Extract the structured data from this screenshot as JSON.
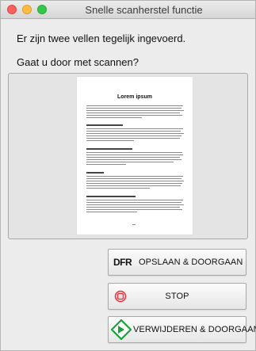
{
  "window": {
    "title": "Snelle scanherstel functie"
  },
  "message": {
    "line1": "Er zijn twee vellen tegelijk ingevoerd.",
    "line2": "Gaat u door met scannen?"
  },
  "preview": {
    "document_title": "Lorem ipsum"
  },
  "buttons": {
    "save_continue": {
      "icon_text": "DFR",
      "label": "OPSLAAN & DOORGAAN"
    },
    "stop": {
      "icon": "stop-icon",
      "label": "STOP"
    },
    "delete_continue": {
      "icon": "green-diamond-arrow-icon",
      "label": "VERWIJDEREN & DOORGAAN"
    }
  },
  "colors": {
    "close": "#fc605c",
    "minimize": "#fdbc40",
    "maximize": "#34c84a",
    "stop_icon": "#e8323c",
    "delete_icon": "#18a03a"
  }
}
